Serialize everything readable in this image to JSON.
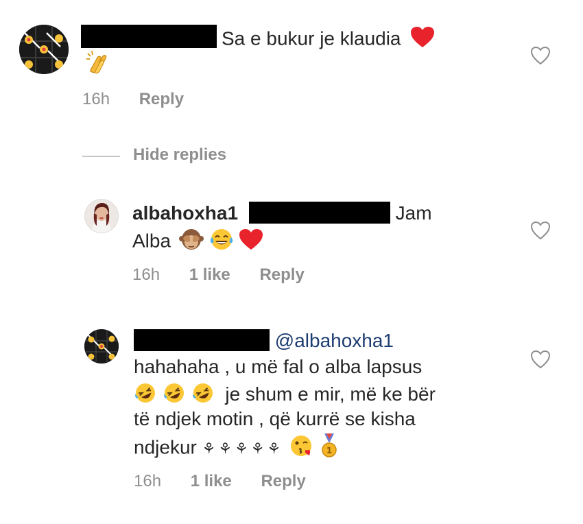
{
  "comment1": {
    "text": "Sa e bukur je klaudia",
    "time": "16h",
    "reply_label": "Reply",
    "emojis": [
      "red-heart-icon",
      "clapping-hands-icon"
    ]
  },
  "hide_replies_label": "Hide replies",
  "reply1": {
    "username": "albahoxha1",
    "text_line1_end": "Jam",
    "text_line2": "Alba",
    "time": "16h",
    "likes": "1 like",
    "reply_label": "Reply",
    "emojis": [
      "see-no-evil-monkey-icon",
      "tears-of-joy-icon",
      "red-heart-icon"
    ]
  },
  "reply2": {
    "mention": "@albahoxha1",
    "line1": "hahahaha , u më fal o alba lapsus",
    "line2": "je shum e mir, më ke bër",
    "line3": "të ndjek motin , që kurrë se kisha",
    "line4": "ndjekur",
    "sprouts": "⚘⚘⚘⚘⚘",
    "time": "16h",
    "likes": "1 like",
    "reply_label": "Reply",
    "emojis": [
      "rolling-laughing-icon",
      "kiss-face-icon",
      "medal-icon"
    ]
  },
  "colors": {
    "text": "#262626",
    "meta": "#8e8e8e",
    "mention": "#1d3c70",
    "heart_red": "#e8232c",
    "redaction": "#000000"
  }
}
